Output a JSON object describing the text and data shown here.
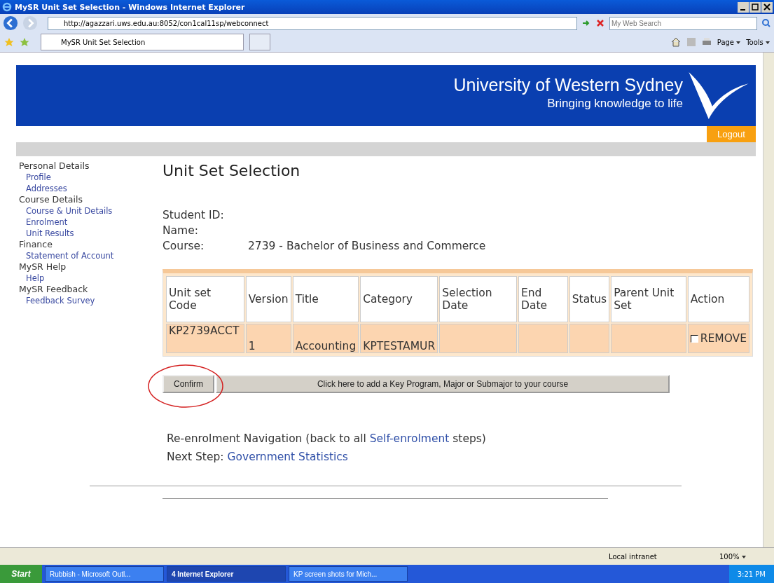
{
  "window": {
    "title": "MySR Unit Set Selection - Windows Internet Explorer"
  },
  "address_bar": {
    "url": "http://agazzari.uws.edu.au:8052/con1cal11sp/webconnect",
    "search_placeholder": "My Web Search"
  },
  "tab": {
    "label": "MySR Unit Set Selection"
  },
  "command_bar": [
    "Page",
    "Tools"
  ],
  "banner": {
    "name": "University of Western Sydney",
    "tagline": "Bringing knowledge to life",
    "logout": "Logout"
  },
  "sidebar": [
    {
      "heading": "Personal Details",
      "links": [
        "Profile",
        "Addresses"
      ]
    },
    {
      "heading": "Course Details",
      "links": [
        "Course & Unit Details",
        "Enrolment",
        "Unit Results"
      ]
    },
    {
      "heading": "Finance",
      "links": [
        "Statement of Account"
      ]
    },
    {
      "heading": "MySR Help",
      "links": [
        "Help"
      ]
    },
    {
      "heading": "MySR Feedback",
      "links": [
        "Feedback Survey"
      ]
    }
  ],
  "page_title": "Unit Set Selection",
  "student": [
    {
      "label": "Student ID:"
    },
    {
      "label": "Name:"
    },
    {
      "label": "Course:",
      "value": "2739 - Bachelor of Business and Commerce"
    }
  ],
  "table": {
    "columns": [
      "Unit set Code",
      "Version",
      "Title",
      "Category",
      "Selection Date",
      "End Date",
      "Status",
      "Parent Unit Set",
      "Action"
    ],
    "rows": [
      {
        "cells": [
          "KP2739ACCT",
          "1",
          "Accounting",
          "KPTESTAMUR",
          "",
          "",
          "",
          ""
        ],
        "action": "REMOVE",
        "checked": false
      }
    ]
  },
  "buttons": {
    "confirm": "Confirm",
    "add": "Click here to add a Key Program, Major or Submajor to your course"
  },
  "annotation": {
    "circled": true
  },
  "navigation": {
    "before": "Re-enrolment Navigation (back to all ",
    "link": "Self-enrolment",
    "after": " steps)",
    "next_label": "Next Step:",
    "next_link": "Government Statistics"
  },
  "status_bar": {
    "zone": "Local intranet",
    "zoom": "100%"
  },
  "taskbar": {
    "start": "Start",
    "items": [
      {
        "label": "Rubbish - Microsoft Outl...",
        "selected": false
      },
      {
        "label": "4 Internet Explorer",
        "selected": true
      },
      {
        "label": "KP screen shots for Mich...",
        "selected": false
      }
    ],
    "time": "3:21 PM"
  }
}
